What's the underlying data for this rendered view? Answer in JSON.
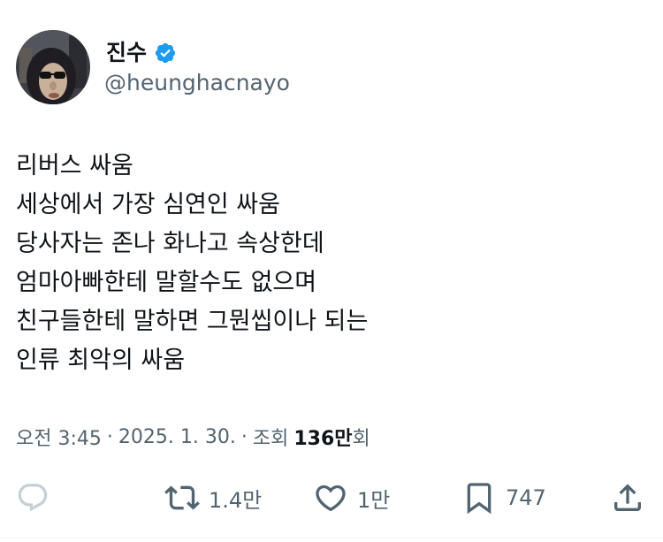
{
  "author": {
    "display_name": "진수",
    "handle": "@heunghacnayo",
    "verified": true
  },
  "tweet": {
    "lines": [
      "리버스 싸움",
      "세상에서 가장 심연인 싸움",
      "당사자는 존나 화나고 속상한데",
      "엄마아빠한테 말할수도 없으며",
      "친구들한테 말하면 그뭔씹이나 되는",
      "인류 최악의 싸움"
    ]
  },
  "meta": {
    "time": "오전 3:45",
    "separator": "·",
    "date": "2025. 1. 30.",
    "views_prefix": "조회",
    "views_count": "136만",
    "views_suffix": "회"
  },
  "actions": {
    "reply": {
      "icon": "reply-icon",
      "count": ""
    },
    "retweet": {
      "icon": "retweet-icon",
      "count": "1.4만"
    },
    "like": {
      "icon": "heart-icon",
      "count": "1만"
    },
    "bookmark": {
      "icon": "bookmark-icon",
      "count": "747"
    },
    "share": {
      "icon": "share-icon"
    }
  },
  "colors": {
    "text_primary": "#0f1419",
    "text_secondary": "#536471",
    "verified_blue": "#1d9bf0",
    "reply_icon_faded": "#c4cfd6"
  }
}
